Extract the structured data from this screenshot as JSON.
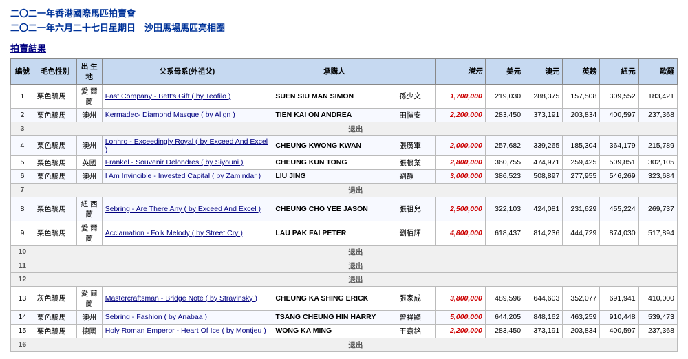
{
  "header": {
    "line1": "二〇二一年香港國際馬匹拍賣會",
    "line2": "二〇二一年六月二十七日星期日　沙田馬場馬匹亮相圈",
    "section": "拍賣結果"
  },
  "columns": {
    "num": "編號",
    "color": "毛色性別",
    "birth_place": "出 生 地",
    "sire": "父系母系(外祖父)",
    "buyer_en": "承購人",
    "buyer_cn": "",
    "hkd": "港元",
    "usd": "美元",
    "aud": "澳元",
    "gbp": "英鎊",
    "nzd": "紐元",
    "eur": "歐羅"
  },
  "rows": [
    {
      "num": "1",
      "color": "栗色騸馬",
      "birth": "愛 爾 蘭",
      "sire": "Fast Company - Bett's Gift ( by Teofilo )",
      "buyer_en": "SUEN SIU MAN SIMON",
      "buyer_cn": "孫少文",
      "hkd": "1,700,000",
      "usd": "219,030",
      "aud": "288,375",
      "gbp": "157,508",
      "nzd": "309,552",
      "eur": "183,421",
      "withdrawn": false
    },
    {
      "num": "2",
      "color": "栗色騸馬",
      "birth": "澳州",
      "sire": "Kermadec- Diamond Masque ( by Align )",
      "buyer_en": "TIEN KAI ON ANDREA",
      "buyer_cn": "田愷安",
      "hkd": "2,200,000",
      "usd": "283,450",
      "aud": "373,191",
      "gbp": "203,834",
      "nzd": "400,597",
      "eur": "237,368",
      "withdrawn": false
    },
    {
      "num": "3",
      "withdrawn": true,
      "withdrawn_text": "退出"
    },
    {
      "num": "4",
      "color": "栗色騸馬",
      "birth": "澳州",
      "sire": "Lonhro - Exceedingly Royal ( by Exceed And Excel )",
      "buyer_en": "CHEUNG KWONG KWAN",
      "buyer_cn": "張廣軍",
      "hkd": "2,000,000",
      "usd": "257,682",
      "aud": "339,265",
      "gbp": "185,304",
      "nzd": "364,179",
      "eur": "215,789",
      "withdrawn": false
    },
    {
      "num": "5",
      "color": "栗色騸馬",
      "birth": "英國",
      "sire": "Frankel - Souvenir Delondres ( by Siyouni )",
      "buyer_en": "CHEUNG KUN TONG",
      "buyer_cn": "張根業",
      "hkd": "2,800,000",
      "usd": "360,755",
      "aud": "474,971",
      "gbp": "259,425",
      "nzd": "509,851",
      "eur": "302,105",
      "withdrawn": false
    },
    {
      "num": "6",
      "color": "栗色騸馬",
      "birth": "澳州",
      "sire": "I Am Invincible - Invested Capital ( by Zamindar )",
      "buyer_en": "LIU JING",
      "buyer_cn": "劉靜",
      "hkd": "3,000,000",
      "usd": "386,523",
      "aud": "508,897",
      "gbp": "277,955",
      "nzd": "546,269",
      "eur": "323,684",
      "withdrawn": false
    },
    {
      "num": "7",
      "withdrawn": true,
      "withdrawn_text": "退出"
    },
    {
      "num": "8",
      "color": "栗色騸馬",
      "birth": "紐 西 蘭",
      "sire": "Sebring - Are There Any ( by Exceed And Excel )",
      "buyer_en": "CHEUNG CHO YEE JASON",
      "buyer_cn": "張祖兒",
      "hkd": "2,500,000",
      "usd": "322,103",
      "aud": "424,081",
      "gbp": "231,629",
      "nzd": "455,224",
      "eur": "269,737",
      "withdrawn": false
    },
    {
      "num": "9",
      "color": "栗色騸馬",
      "birth": "愛 爾 蘭",
      "sire": "Acclamation - Folk Melody ( by Street Cry )",
      "buyer_en": "LAU PAK FAI PETER",
      "buyer_cn": "劉栢輝",
      "hkd": "4,800,000",
      "usd": "618,437",
      "aud": "814,236",
      "gbp": "444,729",
      "nzd": "874,030",
      "eur": "517,894",
      "withdrawn": false
    },
    {
      "num": "10",
      "withdrawn": true,
      "withdrawn_text": "退出"
    },
    {
      "num": "11",
      "withdrawn": true,
      "withdrawn_text": "退出"
    },
    {
      "num": "12",
      "withdrawn": true,
      "withdrawn_text": "退出"
    },
    {
      "num": "13",
      "color": "灰色騸馬",
      "birth": "愛 爾 蘭",
      "sire": "Mastercraftsman - Bridge Note ( by Stravinsky )",
      "buyer_en": "CHEUNG KA SHING ERICK",
      "buyer_cn": "張家成",
      "hkd": "3,800,000",
      "usd": "489,596",
      "aud": "644,603",
      "gbp": "352,077",
      "nzd": "691,941",
      "eur": "410,000",
      "withdrawn": false
    },
    {
      "num": "14",
      "color": "栗色騸馬",
      "birth": "澳州",
      "sire": "Sebring - Fashion ( by Anabaa )",
      "buyer_en": "TSANG CHEUNG HIN HARRY",
      "buyer_cn": "曾祥顯",
      "hkd": "5,000,000",
      "usd": "644,205",
      "aud": "848,162",
      "gbp": "463,259",
      "nzd": "910,448",
      "eur": "539,473",
      "withdrawn": false
    },
    {
      "num": "15",
      "color": "栗色騸馬",
      "birth": "德國",
      "sire": "Holy Roman Emperor - Heart Of Ice ( by Montjeu )",
      "buyer_en": "WONG KA MING",
      "buyer_cn": "王嘉銘",
      "hkd": "2,200,000",
      "usd": "283,450",
      "aud": "373,191",
      "gbp": "203,834",
      "nzd": "400,597",
      "eur": "237,368",
      "withdrawn": false
    },
    {
      "num": "16",
      "withdrawn": true,
      "withdrawn_text": "退出"
    }
  ]
}
